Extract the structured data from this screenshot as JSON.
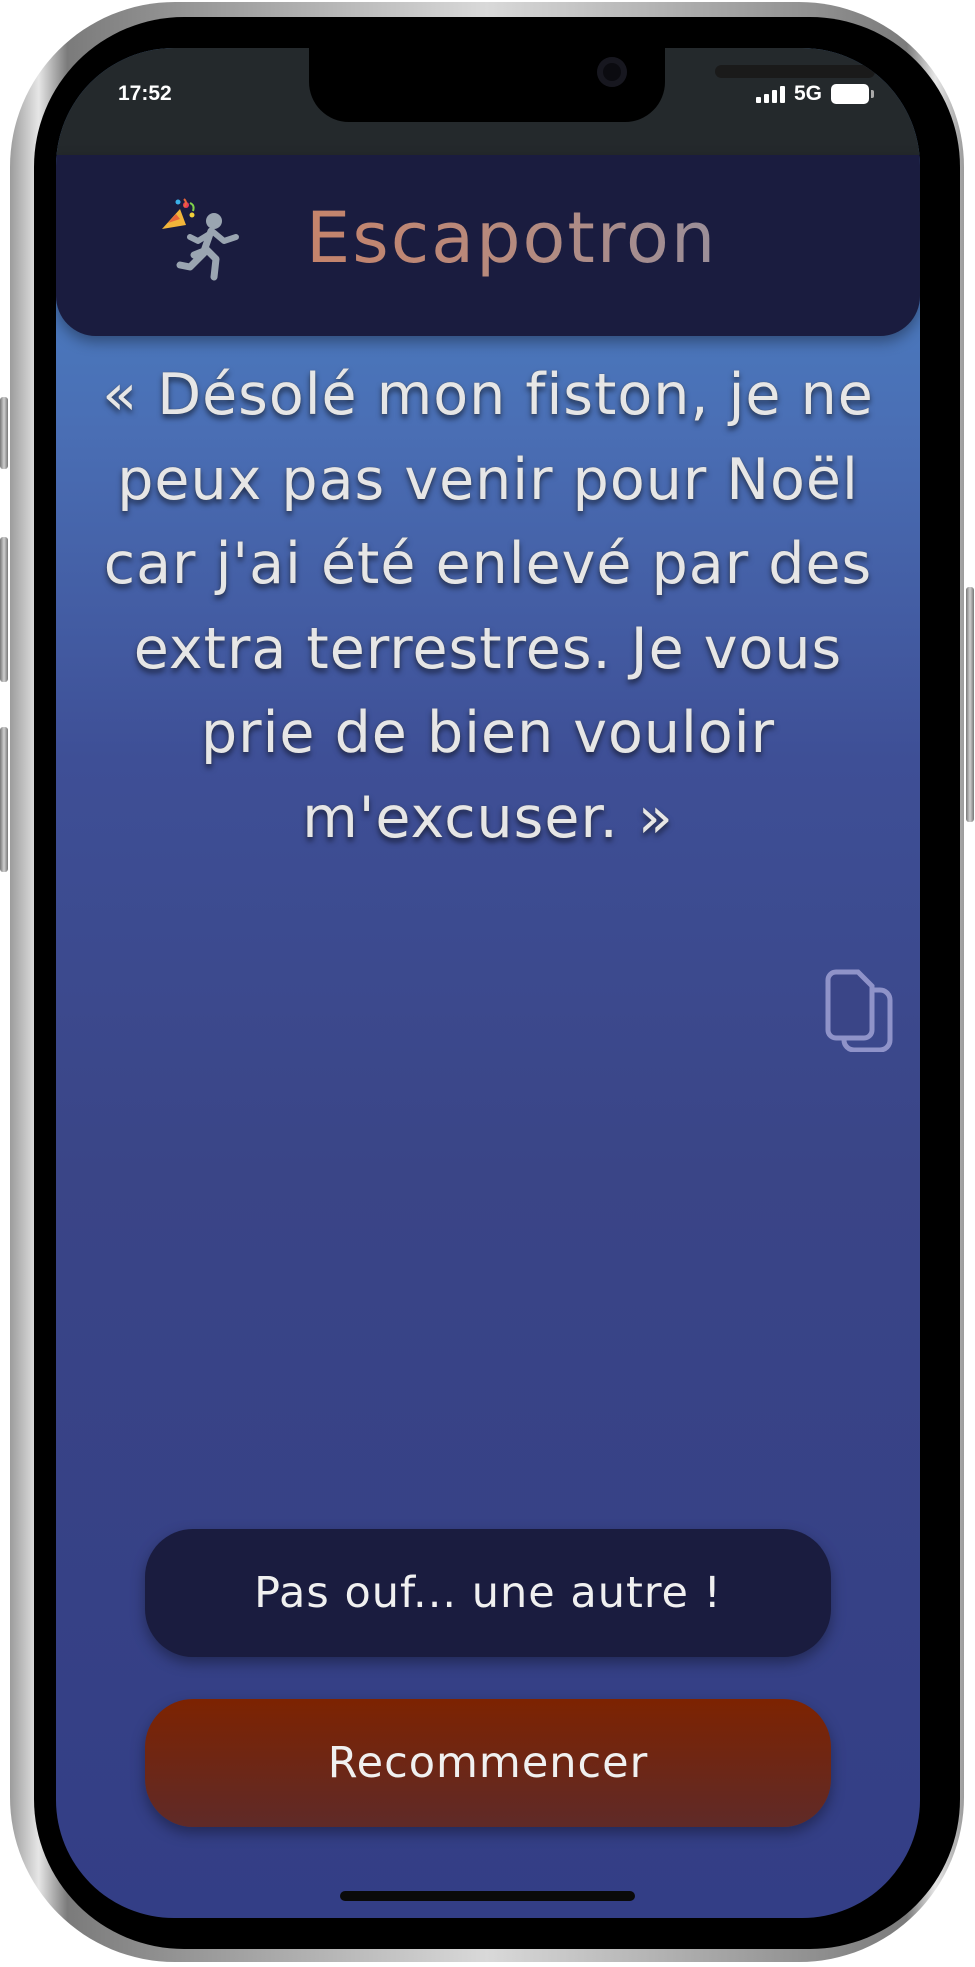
{
  "status_bar": {
    "time": "17:52",
    "network": "5G"
  },
  "header": {
    "app_title": "Escapotron"
  },
  "main": {
    "excuse_text": "« Désolé mon fiston, je ne peux pas venir pour Noël car j'ai été enlevé par des extra terrestres. Je vous prie de bien vouloir m'excuser. »"
  },
  "actions": {
    "another_label": "Pas ouf... une autre !",
    "restart_label": "Recommencer"
  },
  "icons": {
    "logo": "party-popper-running-person-icon",
    "copy": "copy-icon"
  },
  "colors": {
    "header_bg": "#1a1c3f",
    "accent_title": "#c5836b",
    "restart_button": "#7d2301"
  }
}
